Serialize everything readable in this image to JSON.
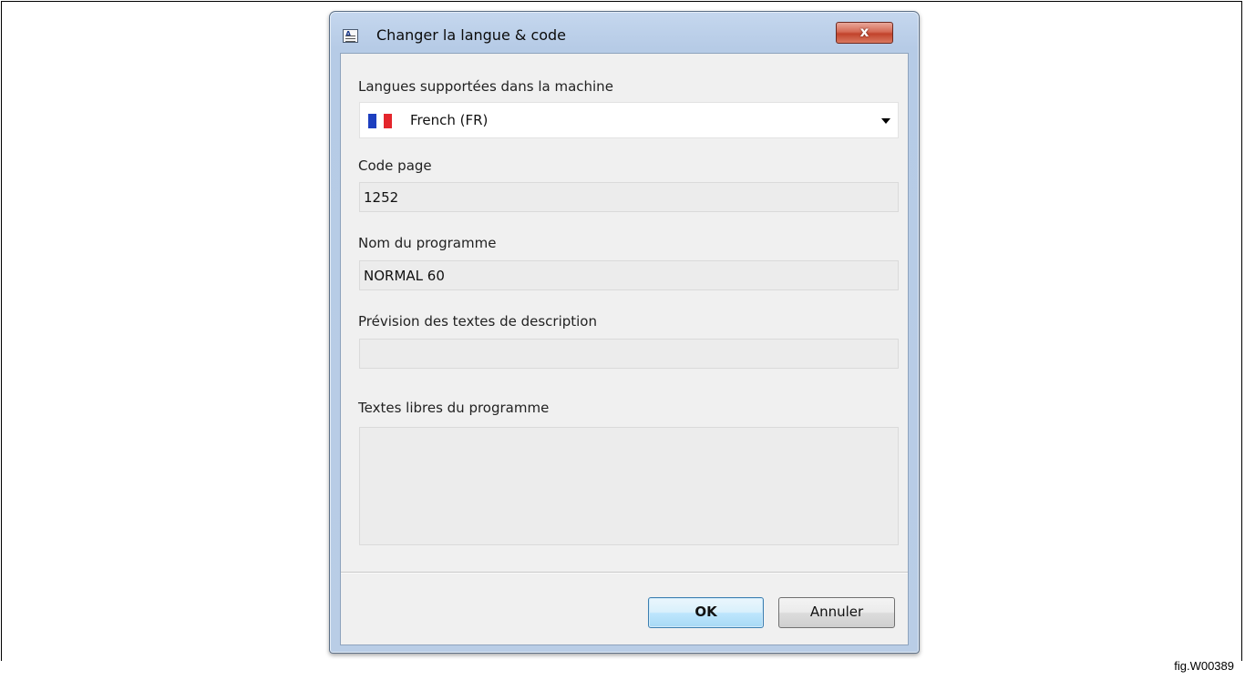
{
  "window": {
    "title": "Changer la langue & code",
    "icon": "dialog-app-icon",
    "close_label": "x"
  },
  "form": {
    "language_label": "Langues supportées dans la machine",
    "language_value": "French (FR)",
    "language_flag": "french-flag",
    "code_page_label": "Code page",
    "code_page_value": "1252",
    "program_name_label": "Nom du programme",
    "program_name_value": "NORMAL 60",
    "description_preview_label": "Prévision des textes de description",
    "description_preview_value": "",
    "free_texts_label": "Textes libres du programme",
    "free_texts_value": ""
  },
  "buttons": {
    "ok_label": "OK",
    "cancel_label": "Annuler"
  },
  "figure_label": "fig.W00389",
  "colors": {
    "flag_blue": "#1d3fbf",
    "flag_white": "#ffffff",
    "flag_red": "#e4262c",
    "close_button": "#c2432c",
    "ok_button_border": "#3c7fb1"
  }
}
